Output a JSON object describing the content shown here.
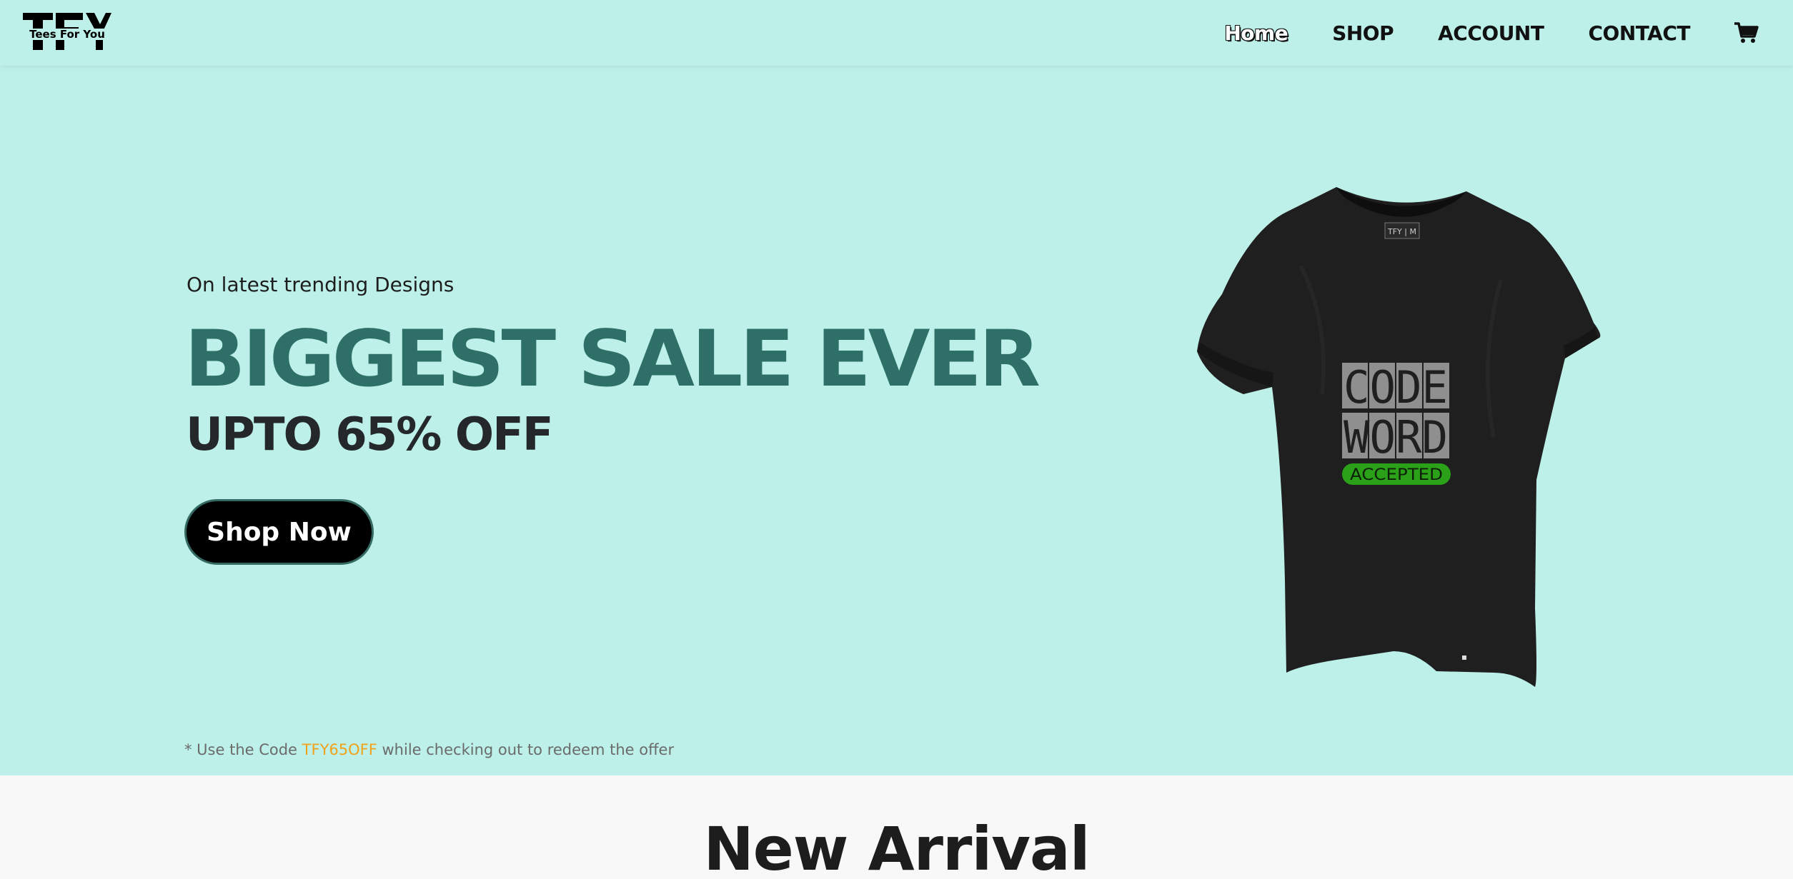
{
  "brand": {
    "logo_text": "TFY",
    "tagline": "Tees For You"
  },
  "nav": {
    "links": [
      "Home",
      "SHOP",
      "ACCOUNT",
      "CONTACT"
    ],
    "cart_icon": "cart-icon"
  },
  "hero": {
    "subtitle": "On latest trending Designs",
    "title": "BIGGEST SALE EVER",
    "discount": "UPTO 65% OFF",
    "cta_label": "Shop Now",
    "note_prefix": "* Use the Code ",
    "promo_code": "TFY65OFF",
    "note_suffix": " while checking out to redeem the offer",
    "product": {
      "line1": "CODE",
      "line2": "WORD",
      "badge": "ACCEPTED",
      "neck_label": "TFY | M"
    }
  },
  "section": {
    "title": "New Arrival"
  },
  "colors": {
    "hero_bg": "#bdf0e8",
    "title_green": "#2e7068",
    "promo_orange": "#f0a21a",
    "badge_green": "#2aa118"
  }
}
